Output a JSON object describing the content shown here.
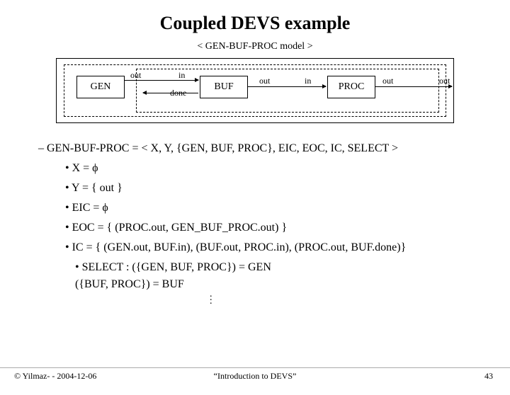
{
  "title": "Coupled DEVS example",
  "subtitle": "< GEN-BUF-PROC model >",
  "diagram": {
    "gen": "GEN",
    "buf": "BUF",
    "proc": "PROC",
    "ports": {
      "gen_out": "out",
      "buf_in": "in",
      "buf_done": "done",
      "buf_out": "out",
      "proc_in": "in",
      "proc_out": "out",
      "ext_out": "out"
    }
  },
  "definition": {
    "main": "–  GEN-BUF-PROC = < X, Y, {GEN, BUF, PROC}, EIC, EOC, IC, SELECT >",
    "items": [
      "•  X = ϕ",
      "•  Y = { out }",
      "•  EIC = ϕ",
      "•  EOC = { (PROC.out, GEN_BUF_PROC.out) }",
      "•  IC = { (GEN.out, BUF.in), (BUF.out, PROC.in), (PROC.out, BUF.done)}"
    ],
    "select1": "•  SELECT : ({GEN, BUF, PROC}) = GEN",
    "select2": "({BUF, PROC}) = BUF"
  },
  "footer": {
    "left": "© Yilmaz- -  2004-12-06",
    "center": "“Introduction to DEVS”",
    "right": "43"
  }
}
